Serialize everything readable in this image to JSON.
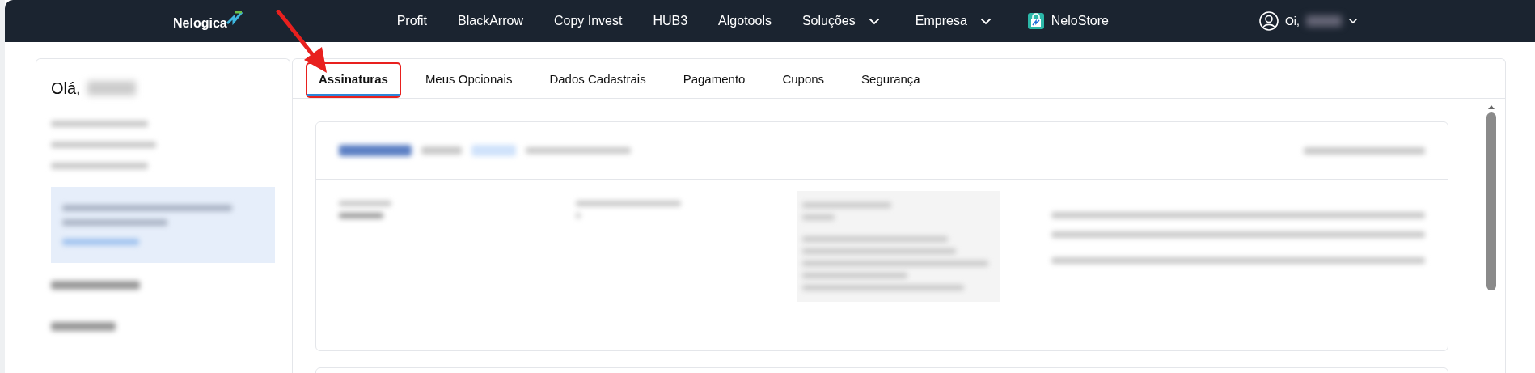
{
  "navbar": {
    "logo": "Nelogica",
    "items": [
      {
        "label": "Profit",
        "kind": "link"
      },
      {
        "label": "BlackArrow",
        "kind": "link"
      },
      {
        "label": "Copy Invest",
        "kind": "link"
      },
      {
        "label": "HUB3",
        "kind": "link"
      },
      {
        "label": "Algotools",
        "kind": "link"
      },
      {
        "label": "Soluções",
        "kind": "dropdown"
      },
      {
        "label": "Empresa",
        "kind": "dropdown"
      },
      {
        "label": "NeloStore",
        "kind": "store"
      }
    ],
    "user_greeting": "Oi,"
  },
  "sidebar": {
    "greeting": "Olá,"
  },
  "tabs": [
    {
      "label": "Assinaturas",
      "selected": true
    },
    {
      "label": "Meus Opcionais",
      "selected": false
    },
    {
      "label": "Dados Cadastrais",
      "selected": false
    },
    {
      "label": "Pagamento",
      "selected": false
    },
    {
      "label": "Cupons",
      "selected": false
    },
    {
      "label": "Segurança",
      "selected": false
    }
  ]
}
